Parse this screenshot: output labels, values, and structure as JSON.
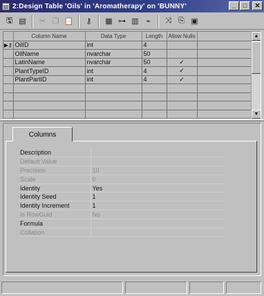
{
  "window": {
    "title": "2:Design Table 'Oils' in 'Aromatherapy' on 'BUNNY'",
    "minimize_glyph": "_",
    "maximize_glyph": "□",
    "close_glyph": "✕"
  },
  "toolbar": {
    "buttons": [
      {
        "name": "save",
        "icon": "floppy-icon",
        "glyph": "🖫",
        "enabled": true
      },
      {
        "name": "properties",
        "icon": "properties-icon",
        "glyph": "▤",
        "enabled": true
      },
      {
        "name": "cut",
        "icon": "scissors-icon",
        "glyph": "✂",
        "enabled": false
      },
      {
        "name": "copy",
        "icon": "copy-icon",
        "glyph": "❐",
        "enabled": false
      },
      {
        "name": "paste",
        "icon": "paste-icon",
        "glyph": "📋",
        "enabled": true
      },
      {
        "name": "set-primary-key",
        "icon": "key-icon",
        "glyph": "⚷",
        "enabled": true
      },
      {
        "name": "change-table",
        "icon": "table-icon",
        "glyph": "▦",
        "enabled": true
      },
      {
        "name": "manage-relationships",
        "icon": "relationships-icon",
        "glyph": "⊶",
        "enabled": true
      },
      {
        "name": "manage-indexes",
        "icon": "indexes-icon",
        "glyph": "▥",
        "enabled": true
      },
      {
        "name": "manage-triggers",
        "icon": "trigger-icon",
        "glyph": "⌁",
        "enabled": true
      },
      {
        "name": "generate-script",
        "icon": "script-icon",
        "glyph": "⤨",
        "enabled": true
      },
      {
        "name": "save-change-script",
        "icon": "save-script-icon",
        "glyph": "⎘",
        "enabled": true
      },
      {
        "name": "manage-constraints",
        "icon": "constraints-icon",
        "glyph": "▣",
        "enabled": true
      }
    ]
  },
  "grid": {
    "headers": [
      "Column Name",
      "Data Type",
      "Length",
      "Allow Nulls"
    ],
    "rows": [
      {
        "selector": "▶⚷",
        "name": "OilID",
        "type": "int",
        "length": "4",
        "nulls": ""
      },
      {
        "selector": "",
        "name": "OilName",
        "type": "nvarchar",
        "length": "50",
        "nulls": ""
      },
      {
        "selector": "",
        "name": "LatinName",
        "type": "nvarchar",
        "length": "50",
        "nulls": "✓"
      },
      {
        "selector": "",
        "name": "PlantTypeID",
        "type": "int",
        "length": "4",
        "nulls": "✓"
      },
      {
        "selector": "",
        "name": "PlantPartID",
        "type": "int",
        "length": "4",
        "nulls": "✓"
      }
    ],
    "empty_rows": 4,
    "scroll_up": "▲",
    "scroll_down": "▼"
  },
  "columns_tab": {
    "label": "Columns",
    "properties": [
      {
        "label": "Description",
        "value": "",
        "enabled": true
      },
      {
        "label": "Default Value",
        "value": "",
        "enabled": false
      },
      {
        "label": "Precision",
        "value": "10",
        "enabled": false
      },
      {
        "label": "Scale",
        "value": "0",
        "enabled": false
      },
      {
        "label": "Identity",
        "value": "Yes",
        "enabled": true
      },
      {
        "label": "Identity Seed",
        "value": "1",
        "enabled": true
      },
      {
        "label": "Identity Increment",
        "value": "1",
        "enabled": true
      },
      {
        "label": "Is RowGuid",
        "value": "No",
        "enabled": false
      },
      {
        "label": "Formula",
        "value": "",
        "enabled": true
      },
      {
        "label": "Collation",
        "value": "",
        "enabled": false
      }
    ]
  }
}
